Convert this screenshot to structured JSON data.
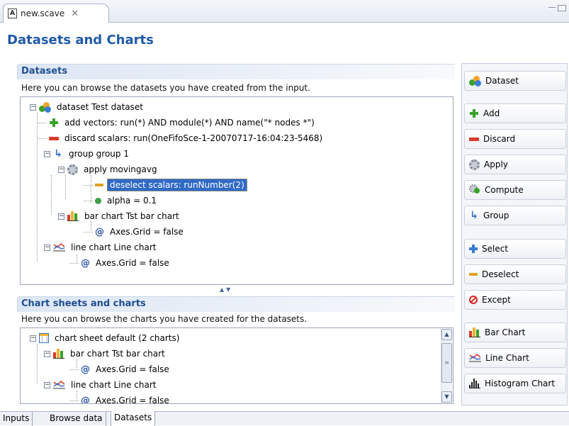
{
  "editor_tab": {
    "label": "new.scave",
    "close": "✕"
  },
  "page_title": "Datasets and Charts",
  "datasets_section": {
    "title": "Datasets",
    "description": "Here you can browse the datasets you have created from the input.",
    "tree": [
      {
        "label": "dataset Test dataset",
        "expander": "−"
      },
      {
        "label": "add vectors: run(*) AND module(*) AND name(\"* nodes *\")"
      },
      {
        "label": "discard scalars: run(OneFifoSce-1-20070717-16:04:23-5468)"
      },
      {
        "label": "group group 1",
        "expander": "−"
      },
      {
        "label": "apply movingavg",
        "expander": "−"
      },
      {
        "label": "deselect scalars: runNumber(2)"
      },
      {
        "label": "alpha = 0.1"
      },
      {
        "label": "bar chart Tst bar chart",
        "expander": "−"
      },
      {
        "label": "Axes.Grid = false"
      },
      {
        "label": "line chart Line chart",
        "expander": "−"
      },
      {
        "label": "Axes.Grid = false"
      }
    ]
  },
  "charts_section": {
    "title": "Chart sheets and charts",
    "description": "Here you can browse the charts you have created for the datasets.",
    "tree": [
      {
        "label": "chart sheet default (2 charts)",
        "expander": "−"
      },
      {
        "label": "bar chart Tst bar chart",
        "expander": "−"
      },
      {
        "label": "Axes.Grid = false"
      },
      {
        "label": "line chart Line chart",
        "expander": "−"
      },
      {
        "label": "Axes.Grid = false"
      }
    ]
  },
  "buttons": {
    "dataset": "Dataset",
    "add": "Add",
    "discard": "Discard",
    "apply": "Apply",
    "compute": "Compute",
    "group": "Group",
    "select": "Select",
    "deselect": "Deselect",
    "except": "Except",
    "bar_chart": "Bar Chart",
    "line_chart": "Line Chart",
    "histogram_chart": "Histogram Chart"
  },
  "bottom_tabs": [
    "Inputs",
    "Browse data",
    "Datasets"
  ],
  "colors": {
    "title_blue": "#1f5aa8",
    "selection": "#316ac5",
    "section_head": "#1f4f8f"
  }
}
